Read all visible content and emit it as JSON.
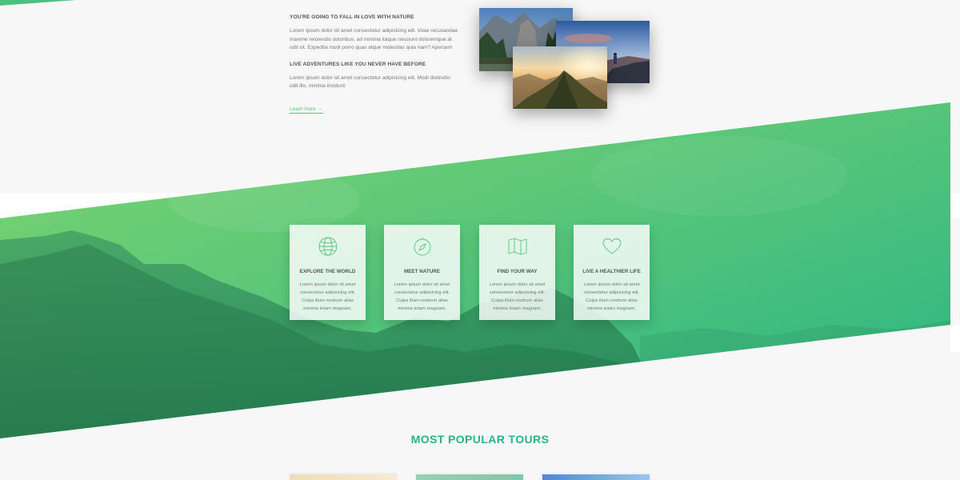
{
  "about": {
    "heading_1": "YOU'RE GOING TO FALL IN LOVE WITH NATURE",
    "paragraph_1": "Lorem ipsum dolor sit amet consectetur adipisicing elit. Vitae recusandae maxime reiciendis doloribus, ad minima itaque nesciunt doloremque at odit sit. Expedita modi porro quas atque molestias quia nam? Aperiam!",
    "heading_2": "LIVE ADVENTURES LIKE YOU NEVER HAVE BEFORE",
    "paragraph_2": "Lorem ipsum dolor sit amet consectetur adipisicing elit. Modi distinctio odit illo, minima incidunt.",
    "learn_more": "Learn more →"
  },
  "features": [
    {
      "icon": "globe-icon",
      "title": "EXPLORE THE WORLD",
      "text": "Lorem ipsum dolor sit amet consectetur adipisicing elit. Culpa illum nostrum alias minima totam magnam,"
    },
    {
      "icon": "compass-icon",
      "title": "MEET NATURE",
      "text": "Lorem ipsum dolor sit amet consectetur adipisicing elit. Culpa illum nostrum alias minima totam magnam,"
    },
    {
      "icon": "map-icon",
      "title": "FIND YOUR WAY",
      "text": "Lorem ipsum dolor sit amet consectetur adipisicing elit. Culpa illum nostrum alias minima totam magnam,"
    },
    {
      "icon": "heart-icon",
      "title": "LIVE A HEALTHIER LIFE",
      "text": "Lorem ipsum dolor sit amet consectetur adipisicing elit. Culpa illum nostrum alias minima totam magnam,"
    }
  ],
  "tours": {
    "heading": "MOST POPULAR TOURS"
  },
  "colors": {
    "primary": "#55c57a",
    "primary_dark": "#28b485",
    "background": "#f7f7f7"
  }
}
